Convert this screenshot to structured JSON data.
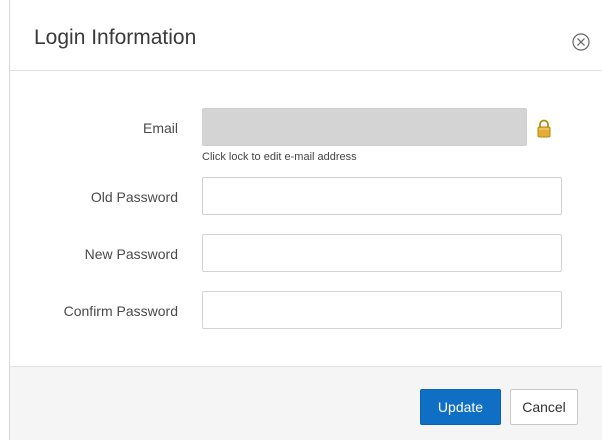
{
  "dialog": {
    "title": "Login Information",
    "close_icon": "close-circle-icon"
  },
  "form": {
    "email": {
      "label": "Email",
      "value": "",
      "locked": true,
      "lock_icon": "lock-icon",
      "helper": "Click lock to edit e-mail address"
    },
    "old_password": {
      "label": "Old Password",
      "value": ""
    },
    "new_password": {
      "label": "New Password",
      "value": ""
    },
    "confirm_password": {
      "label": "Confirm Password",
      "value": ""
    }
  },
  "footer": {
    "update_label": "Update",
    "cancel_label": "Cancel"
  },
  "colors": {
    "primary": "#0f6fc5",
    "disabled_field": "#d4d4d4",
    "lock": "#d8a22a",
    "footer_bg": "#f5f5f5"
  }
}
